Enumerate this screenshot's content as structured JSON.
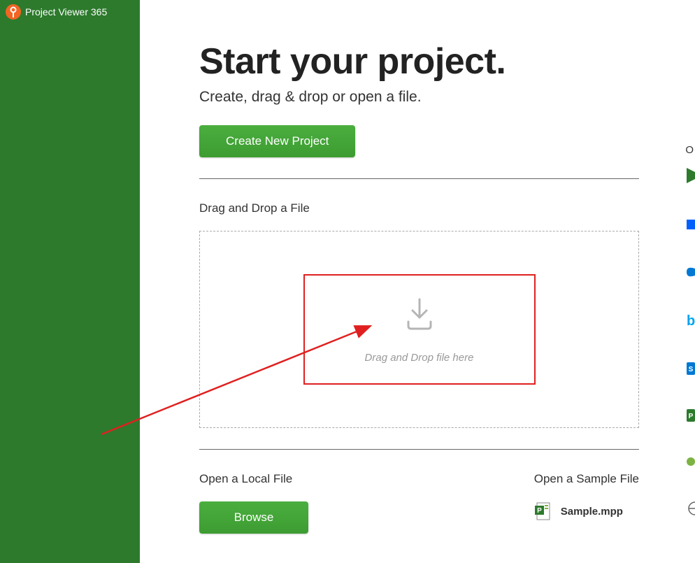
{
  "app": {
    "title": "Project Viewer 365"
  },
  "main": {
    "title": "Start your project.",
    "subtitle": "Create, drag & drop or open a file.",
    "create_button": "Create New Project",
    "drag_drop_label": "Drag and Drop a File",
    "dropzone_text": "Drag and Drop file here",
    "open_local_label": "Open a Local File",
    "browse_button": "Browse",
    "open_sample_label": "Open a Sample File",
    "sample_file_name": "Sample.mpp"
  },
  "right_panel": {
    "label": "O"
  },
  "colors": {
    "sidebar": "#2d7a2d",
    "button": "#4aae3e",
    "annotation": "#e02020"
  }
}
